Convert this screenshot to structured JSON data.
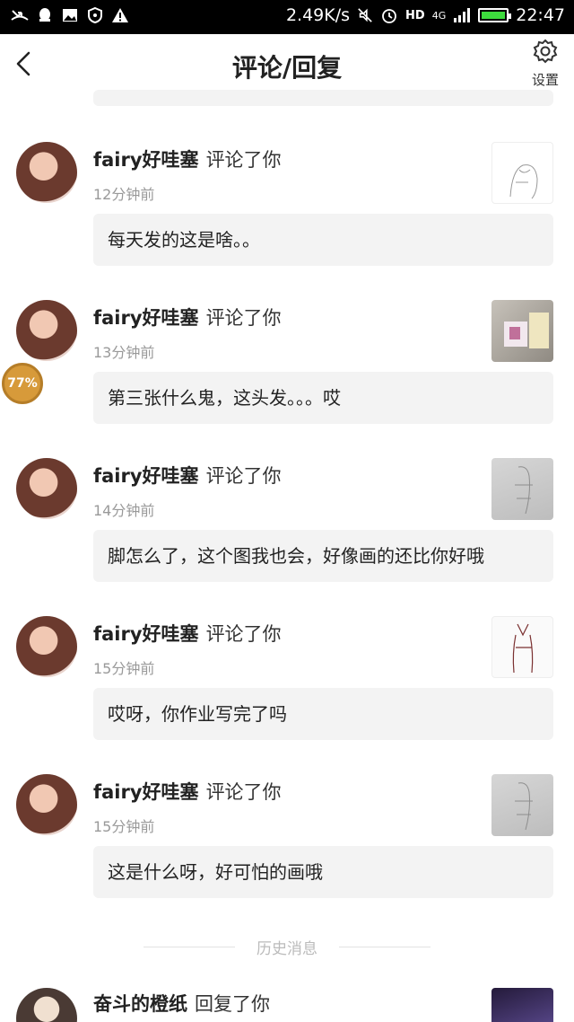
{
  "status_bar": {
    "network_speed": "2.49K/s",
    "network_type": "4G",
    "hd_label": "HD",
    "time": "22:47",
    "battery_level": 0.85,
    "icons": [
      "missed-call-icon",
      "qq-icon",
      "image-icon",
      "shield-icon",
      "warning-icon",
      "mute-icon",
      "alarm-icon",
      "signal-icon",
      "battery-icon"
    ]
  },
  "header": {
    "title": "评论/回复",
    "settings_label": "设置"
  },
  "comments": [
    {
      "user": "fairy好哇塞",
      "action": "评论了你",
      "time": "12分钟前",
      "text": "每天发的这是啥。。",
      "thumb": "sketch"
    },
    {
      "user": "fairy好哇塞",
      "action": "评论了你",
      "time": "13分钟前",
      "text": "第三张什么鬼，这头发。。。哎",
      "thumb": "photo"
    },
    {
      "user": "fairy好哇塞",
      "action": "评论了你",
      "time": "14分钟前",
      "text": "脚怎么了，这个图我也会，好像画的还比你好哦",
      "thumb": "gray"
    },
    {
      "user": "fairy好哇塞",
      "action": "评论了你",
      "time": "15分钟前",
      "text": "哎呀，你作业写完了吗",
      "thumb": "sketch"
    },
    {
      "user": "fairy好哇塞",
      "action": "评论了你",
      "time": "15分钟前",
      "text": "这是什么呀，好可怕的画哦",
      "thumb": "gray"
    }
  ],
  "history_label": "历史消息",
  "last_item": {
    "user": "奋斗的橙纸",
    "action": "回复了你"
  },
  "floating_badge": "77%"
}
